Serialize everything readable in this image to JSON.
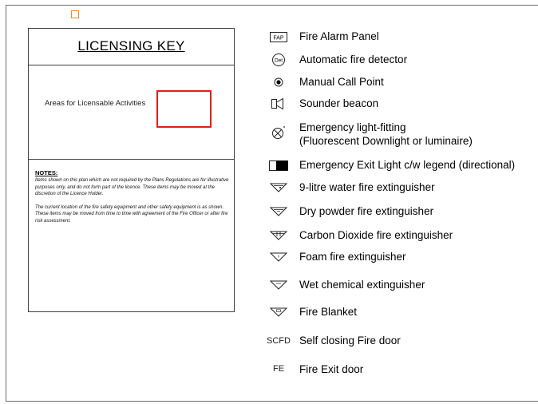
{
  "licensing_key": {
    "title": "LICENSING KEY",
    "area_label": "Areas for Licensable Activities",
    "notes_heading": "NOTES:",
    "note_1": "Items shown on this plan which are not required by the Plans Regulations are for illustrative purposes only, and do not form part of the licence. These items may be moved at the discretion of the Licence Holder.",
    "note_2": "The current location of the fire safety equipment and other safety equipment is as shown. These items may be moved from time to time with agreement of the Fire Officer or after fire risk assessment."
  },
  "legend": {
    "fap_symbol": "FAP",
    "fire_alarm_panel": "Fire Alarm Panel",
    "det_symbol": "Det",
    "fire_detector": "Automatic fire detector",
    "call_point": "Manual Call Point",
    "sounder_beacon": "Sounder beacon",
    "emergency_light_1": "Emergency light-fitting",
    "emergency_light_2": "(Fluorescent Downlight or luminaire)",
    "exit_light": "Emergency Exit Light c/w legend (directional)",
    "water_ext": "9-litre water fire extinguisher",
    "powder_ext": "Dry powder fire extinguisher",
    "co2_ext": "Carbon Dioxide fire extinguisher",
    "foam_ext": "Foam fire extinguisher",
    "wet_chem_ext": "Wet chemical extinguisher",
    "fire_blanket": "Fire Blanket",
    "scfd_symbol": "SCFD",
    "scfd": "Self closing Fire door",
    "fe_symbol": "FE",
    "fire_exit": "Fire Exit door"
  },
  "colors": {
    "licensable_area": "#e01e1e",
    "marker": "#f08a2c"
  }
}
